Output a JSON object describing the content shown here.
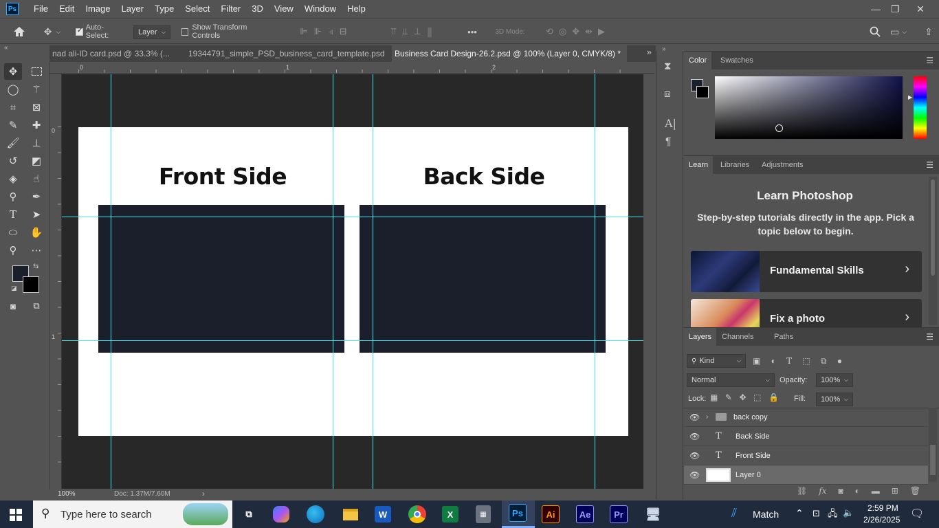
{
  "app": {
    "logo": "Ps"
  },
  "menu": [
    "File",
    "Edit",
    "Image",
    "Layer",
    "Type",
    "Select",
    "Filter",
    "3D",
    "View",
    "Window",
    "Help"
  ],
  "window_controls": {
    "minimize": "—",
    "restore": "❐",
    "close": "✕"
  },
  "options_bar": {
    "auto_select_label": "Auto-Select:",
    "auto_select_value": "Layer",
    "show_transform_label": "Show Transform Controls",
    "more": "•••",
    "mode_3d_label": "3D Mode:"
  },
  "tabs": [
    {
      "label": "nad ali-ID card.psd @ 33.3% (...",
      "close": "×"
    },
    {
      "label": "19344791_simple_PSD_business_card_template.psd",
      "close": "×"
    },
    {
      "label": "Business Card Design-26.2.psd @ 100% (Layer 0, CMYK/8) *",
      "close": "×"
    }
  ],
  "ruler": {
    "top": [
      "0",
      "1",
      "2"
    ],
    "left": [
      "0",
      "1"
    ]
  },
  "document": {
    "front_title": "Front Side",
    "back_title": "Back Side",
    "card_color": "#1b1f2c",
    "guide_color": "#43e8f0"
  },
  "status": {
    "zoom": "100%",
    "doc": "Doc: 1.37M/7.60M",
    "arrow": "›"
  },
  "color_panel": {
    "tabs": [
      "Color",
      "Swatches"
    ]
  },
  "learn_panel": {
    "tabs": [
      "Learn",
      "Libraries",
      "Adjustments"
    ],
    "title": "Learn Photoshop",
    "description": "Step-by-step tutorials directly in the app. Pick a topic below to begin.",
    "cards": [
      {
        "label": "Fundamental Skills",
        "chevron": "›"
      },
      {
        "label": "Fix a photo",
        "chevron": "›"
      }
    ]
  },
  "layers_panel": {
    "tabs": [
      "Layers",
      "Channels",
      "Paths"
    ],
    "filter_label": "Kind",
    "blend_mode": "Normal",
    "opacity_label": "Opacity:",
    "opacity_value": "100%",
    "lock_label": "Lock:",
    "fill_label": "Fill:",
    "fill_value": "100%",
    "layers": [
      {
        "name": "back copy",
        "type": "folder"
      },
      {
        "name": "Back Side",
        "type": "text"
      },
      {
        "name": "Front Side",
        "type": "text"
      },
      {
        "name": "Layer 0",
        "type": "pixel",
        "selected": true
      }
    ]
  },
  "taskbar": {
    "search_placeholder": "Type here to search",
    "weather": "Match",
    "time": "2:59 PM",
    "date": "2/26/2025",
    "apps": [
      "Ai",
      "Ae",
      "Pr",
      "Ps"
    ]
  }
}
